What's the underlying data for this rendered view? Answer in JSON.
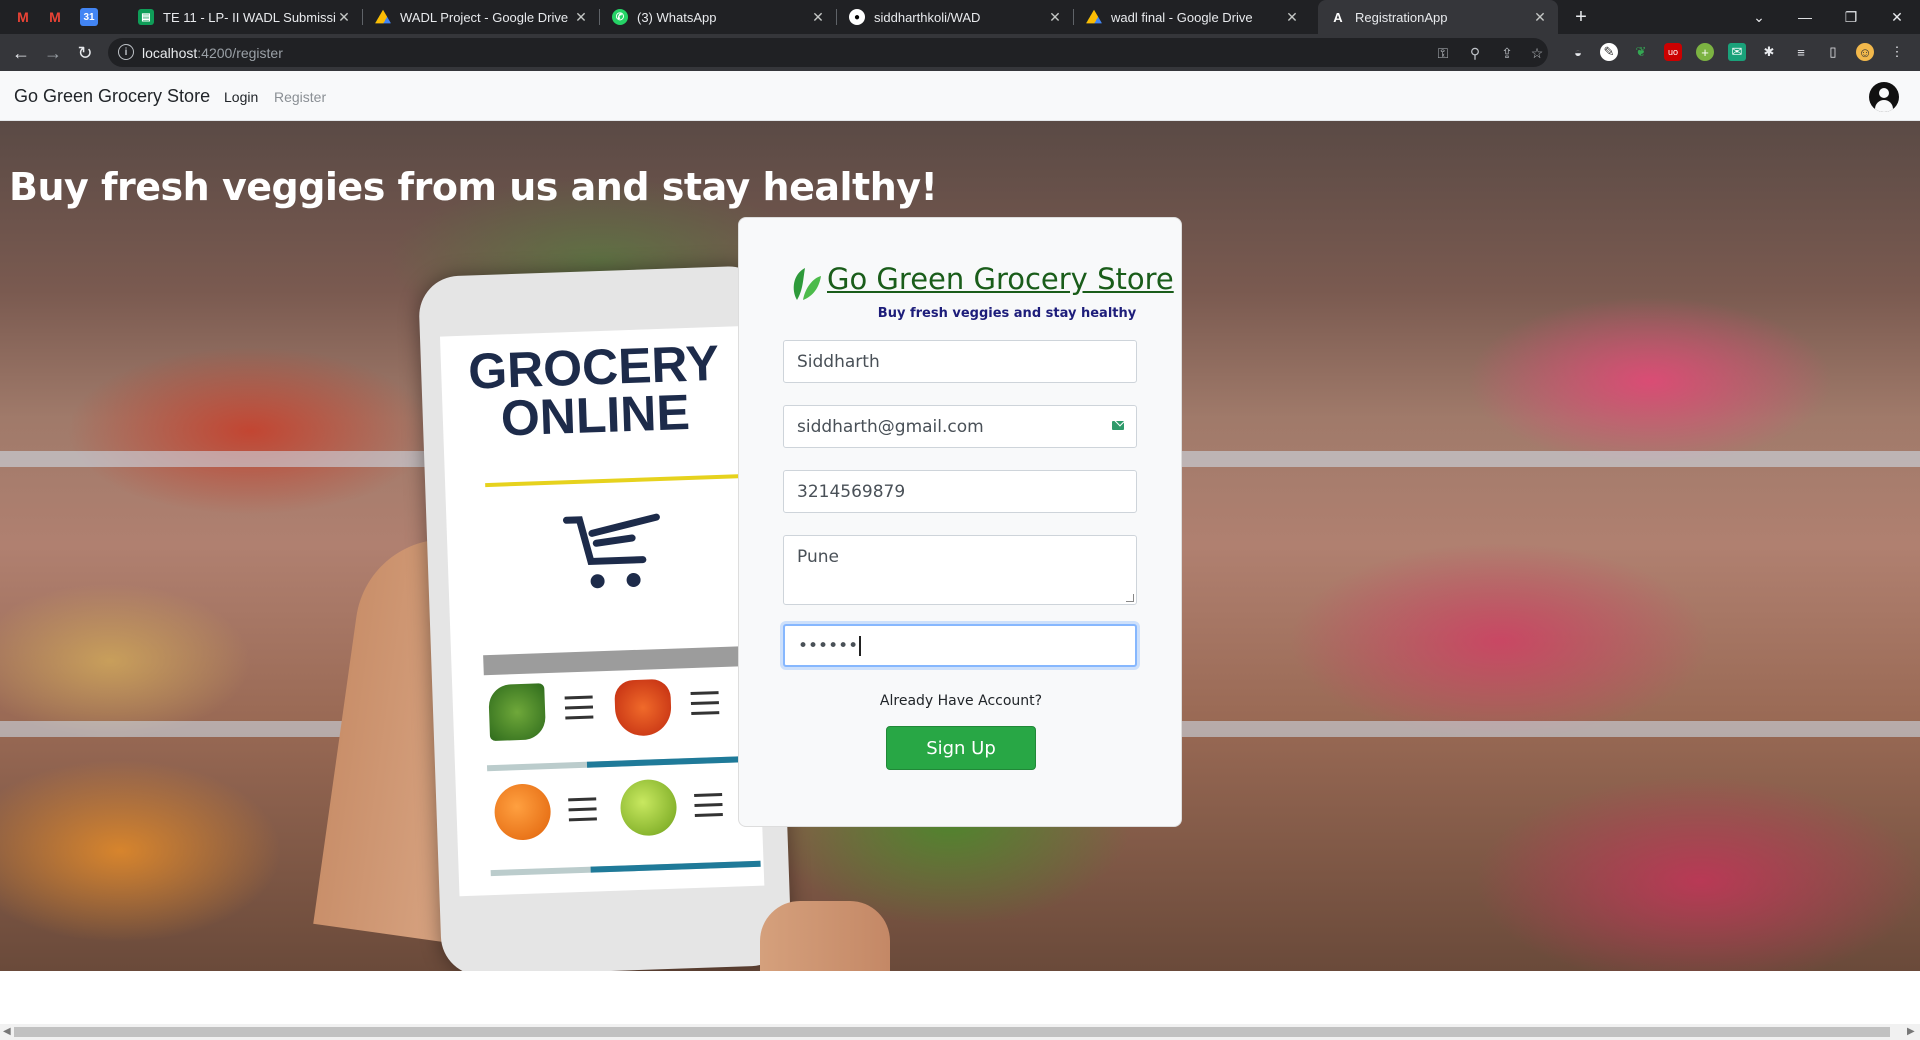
{
  "browser": {
    "tabs": [
      {
        "title": "TE 11 - LP- II WADL Submission /",
        "icon": "sheets-icon",
        "color": "#0f9d58"
      },
      {
        "title": "WADL Project - Google Drive",
        "icon": "drive-icon",
        "color": "#fbbc04"
      },
      {
        "title": "(3) WhatsApp",
        "icon": "whatsapp-icon",
        "color": "#25d366"
      },
      {
        "title": "siddharthkoli/WAD",
        "icon": "github-icon",
        "color": "#ffffff"
      },
      {
        "title": "wadl final - Google Drive",
        "icon": "drive-icon",
        "color": "#fbbc04"
      },
      {
        "title": "RegistrationApp",
        "icon": "angular-icon",
        "color": "#ffffff"
      }
    ],
    "url_host": "localhost",
    "url_path": ":4200/register"
  },
  "navbar": {
    "brand": "Go Green Grocery Store",
    "login": "Login",
    "register": "Register"
  },
  "hero": {
    "title": "Buy fresh veggies from us and stay healthy!",
    "phone_text_1": "GROCERY",
    "phone_text_2": "ONLINE"
  },
  "form": {
    "title": "Go Green Grocery Store",
    "subtitle": "Buy fresh veggies and stay healthy",
    "name_value": "Siddharth",
    "email_value": "siddharth@gmail.com",
    "phone_value": "3214569879",
    "address_value": "Pune",
    "password_value": "••••••",
    "already_text": "Already Have Account?",
    "signup_label": "Sign Up"
  },
  "colors": {
    "accent": "#28a745",
    "title": "#1a5d1a",
    "subtitle": "#1d1d7a"
  }
}
